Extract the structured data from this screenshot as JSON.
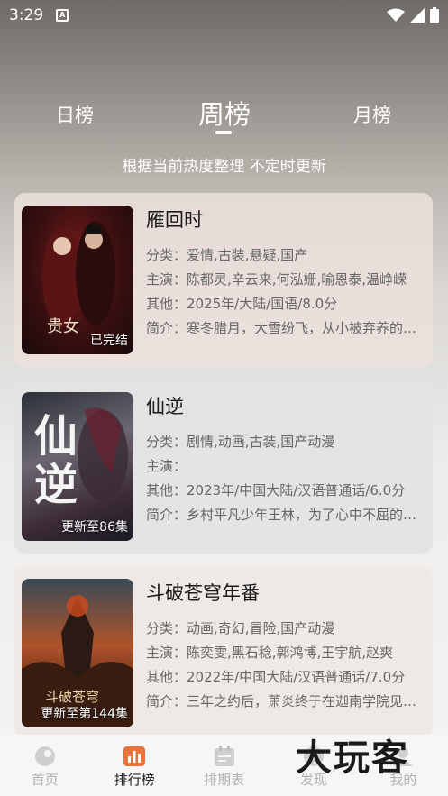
{
  "status_bar": {
    "time": "3:29",
    "app_icon": "A"
  },
  "tabs": {
    "day": "日榜",
    "week": "周榜",
    "month": "月榜"
  },
  "subtitle": "根据当前热度整理 不定时更新",
  "cards": [
    {
      "title": "雁回时",
      "badge": "已完结",
      "poster_text": "贵女",
      "category": "分类：爱情,古装,悬疑,国产",
      "cast": "主演：陈都灵,辛云来,何泓姗,喻恩泰,温峥嵘",
      "other": "其他：2025年/大陆/国语/8.0分",
      "intro": "简介：寒冬腊月，大雪纷飞，从小被弃养的庄寒雁"
    },
    {
      "title": "仙逆",
      "badge": "更新至86集",
      "poster_text": "仙逆",
      "category": "分类：剧情,动画,古装,国产动漫",
      "cast": "主演：",
      "other": "其他：2023年/中国大陆/汉语普通话/6.0分",
      "intro": "简介：乡村平凡少年王林，为了心中不屈的执念"
    },
    {
      "title": "斗破苍穹年番",
      "badge": "更新至第144集",
      "poster_text": "斗破苍穹",
      "category": "分类：动画,奇幻,冒险,国产动漫",
      "cast": "主演：陈奕雯,黑石稔,郭鸿博,王宇航,赵爽",
      "other": "其他：2022年/中国大陆/汉语普通话/7.0分",
      "intro": "简介：三年之约后，萧炎终于在迦南学院见到了"
    }
  ],
  "bottom_nav": [
    {
      "label": "首页",
      "icon": "home-icon"
    },
    {
      "label": "排行榜",
      "icon": "ranking-icon"
    },
    {
      "label": "排期表",
      "icon": "schedule-icon"
    },
    {
      "label": "发现",
      "icon": "discover-icon"
    },
    {
      "label": "我的",
      "icon": "profile-icon"
    }
  ],
  "watermark": "大玩客",
  "colors": {
    "active": "#222222",
    "inactive": "#b0b0b0",
    "ranking_accent": "#e8743b"
  }
}
